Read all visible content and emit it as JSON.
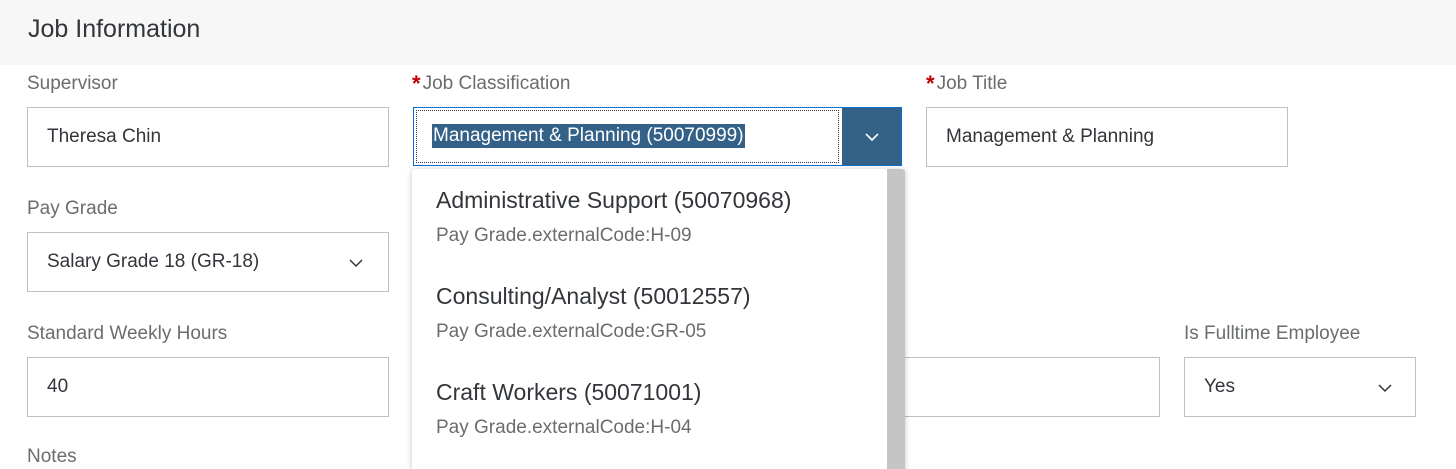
{
  "section": {
    "title": "Job Information"
  },
  "fields": {
    "supervisor": {
      "label": "Supervisor",
      "value": "Theresa Chin"
    },
    "job_classification": {
      "required_mark": "*",
      "label": "Job Classification",
      "value": "Management & Planning (50070999)"
    },
    "job_title": {
      "required_mark": "*",
      "label": "Job Title",
      "value": "Management & Planning"
    },
    "pay_grade": {
      "label": "Pay Grade",
      "value": "Salary Grade 18 (GR-18)"
    },
    "standard_weekly_hours": {
      "label": "Standard Weekly Hours",
      "value": "40"
    },
    "is_fulltime_employee": {
      "label": "Is Fulltime Employee",
      "value": "Yes"
    },
    "notes": {
      "label": "Notes"
    }
  },
  "dropdown": {
    "items": [
      {
        "title": "Administrative Support (50070968)",
        "subtitle": "Pay Grade.externalCode:H-09"
      },
      {
        "title": "Consulting/Analyst (50012557)",
        "subtitle": "Pay Grade.externalCode:GR-05"
      },
      {
        "title": "Craft Workers (50071001)",
        "subtitle": "Pay Grade.externalCode:H-04"
      }
    ]
  },
  "colors": {
    "accent": "#346187",
    "required": "#bb0000",
    "header_bg": "#f7f7f7",
    "border": "#bfbfbf"
  },
  "icons": {
    "dropdown_arrow": "chevron-down-icon"
  }
}
